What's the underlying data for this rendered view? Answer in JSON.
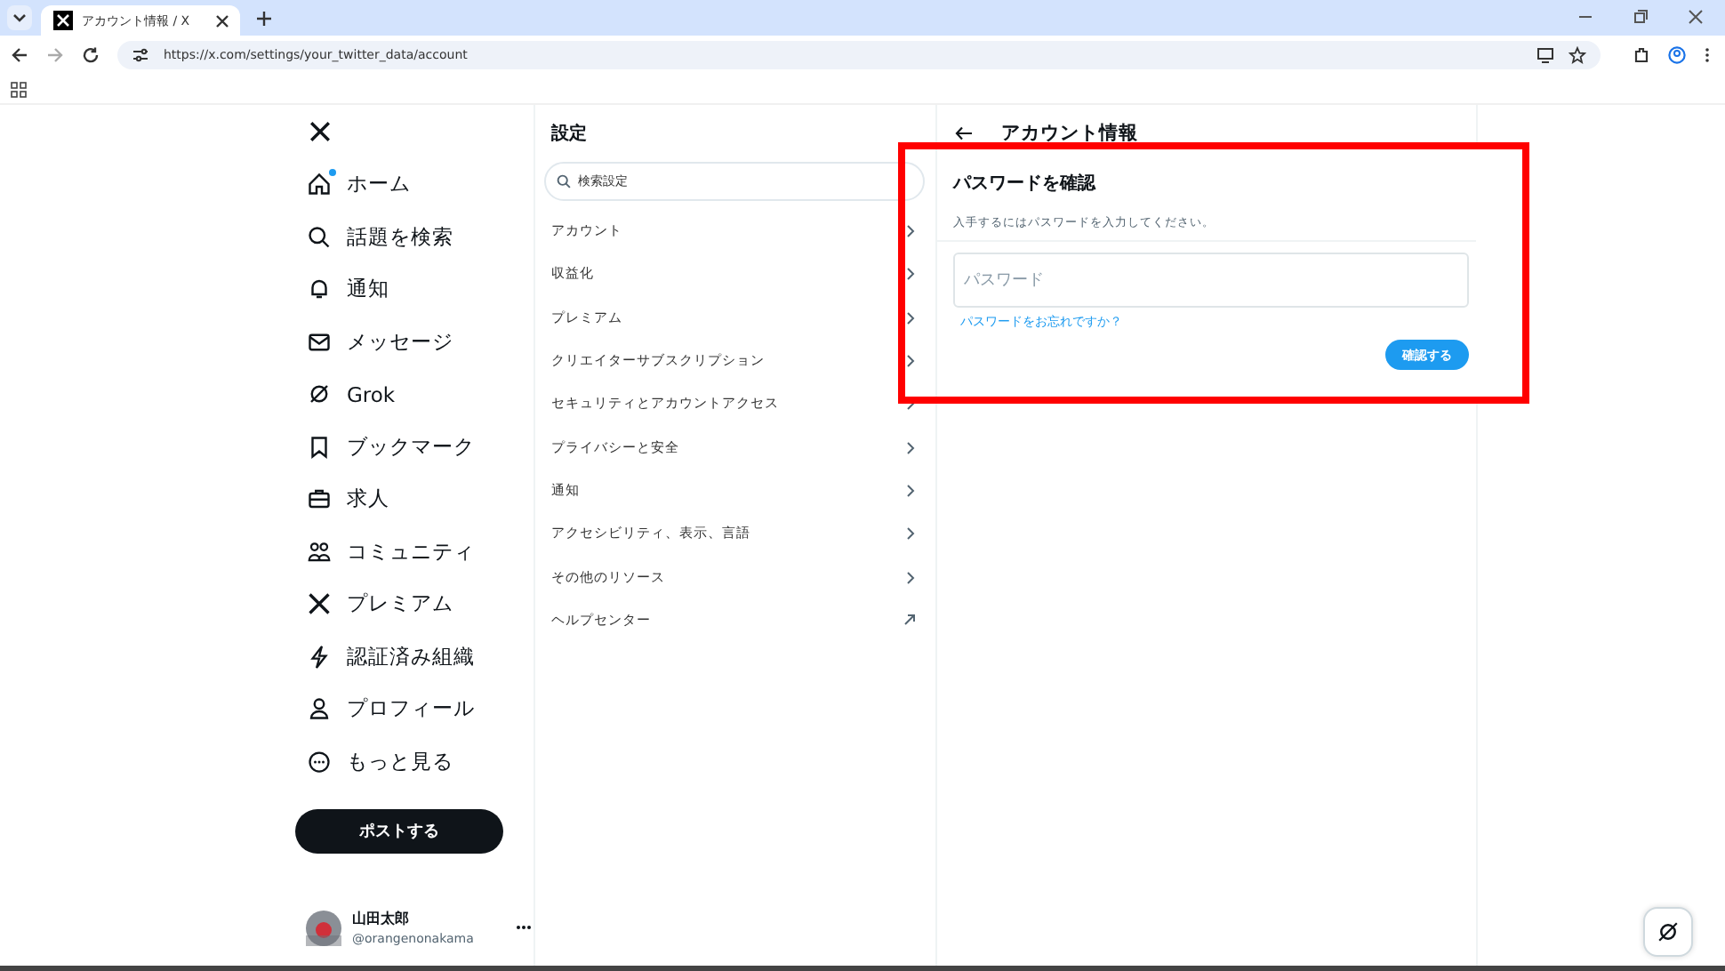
{
  "browser": {
    "tab": {
      "title": "アカウント情報 / X"
    },
    "url": "https://x.com/settings/your_twitter_data/account"
  },
  "nav": {
    "items": [
      {
        "label": "ホーム",
        "notification_dot": true
      },
      {
        "label": "話題を検索",
        "notification_dot": false
      },
      {
        "label": "通知",
        "notification_dot": false
      },
      {
        "label": "メッセージ",
        "notification_dot": false
      },
      {
        "label": "Grok",
        "notification_dot": false
      },
      {
        "label": "ブックマーク",
        "notification_dot": false
      },
      {
        "label": "求人",
        "notification_dot": false
      },
      {
        "label": "コミュニティ",
        "notification_dot": false
      },
      {
        "label": "プレミアム",
        "notification_dot": false
      },
      {
        "label": "認証済み組織",
        "notification_dot": false
      },
      {
        "label": "プロフィール",
        "notification_dot": false
      },
      {
        "label": "もっと見る",
        "notification_dot": false
      }
    ],
    "post_button": "ポストする",
    "account": {
      "name": "山田太郎",
      "handle": "@orangenonakama"
    }
  },
  "settings": {
    "title": "設定",
    "search": {
      "placeholder": "検索設定"
    },
    "items": [
      {
        "label": "アカウント",
        "kind": "chevron"
      },
      {
        "label": "収益化",
        "kind": "chevron"
      },
      {
        "label": "プレミアム",
        "kind": "chevron"
      },
      {
        "label": "クリエイターサブスクリプション",
        "kind": "chevron"
      },
      {
        "label": "セキュリティとアカウントアクセス",
        "kind": "chevron"
      },
      {
        "label": "プライバシーと安全",
        "kind": "chevron"
      },
      {
        "label": "通知",
        "kind": "chevron"
      },
      {
        "label": "アクセシビリティ、表示、言語",
        "kind": "chevron"
      },
      {
        "label": "その他のリソース",
        "kind": "chevron"
      },
      {
        "label": "ヘルプセンター",
        "kind": "external"
      }
    ]
  },
  "detail": {
    "title": "アカウント情報"
  },
  "dialog": {
    "title": "パスワードを確認",
    "description": "入手するにはパスワードを入力してください。",
    "password": {
      "placeholder": "パスワード"
    },
    "forgot_link": "パスワードをお忘れですか？",
    "confirm_button": "確認する"
  }
}
